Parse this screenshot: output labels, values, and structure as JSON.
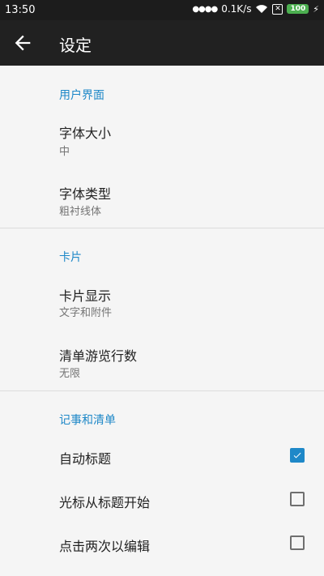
{
  "status_bar": {
    "time": "13:50",
    "net_speed": "0.1K/s",
    "sim_icon_label": "✕",
    "battery": "100",
    "icons": [
      "signal-dots-icon",
      "wifi-icon",
      "no-sim-icon",
      "battery-icon",
      "charging-icon"
    ]
  },
  "app_bar": {
    "title": "设定",
    "back_icon": "back-arrow-icon"
  },
  "colors": {
    "accent": "#1e88c8",
    "app_bar_bg": "#212121",
    "background": "#f5f5f5"
  },
  "sections": {
    "ui": {
      "header": "用户界面",
      "font_size": {
        "title": "字体大小",
        "value": "中"
      },
      "font_type": {
        "title": "字体类型",
        "value": "粗衬线体"
      }
    },
    "cards": {
      "header": "卡片",
      "card_display": {
        "title": "卡片显示",
        "value": "文字和附件"
      },
      "list_lines": {
        "title": "清单游览行数",
        "value": "无限"
      }
    },
    "notes": {
      "header": "记事和清单",
      "auto_title": {
        "title": "自动标题",
        "checked": true
      },
      "cursor_title": {
        "title": "光标从标题开始",
        "checked": false
      },
      "double_tap": {
        "title": "点击两次以编辑",
        "checked": false
      }
    }
  }
}
